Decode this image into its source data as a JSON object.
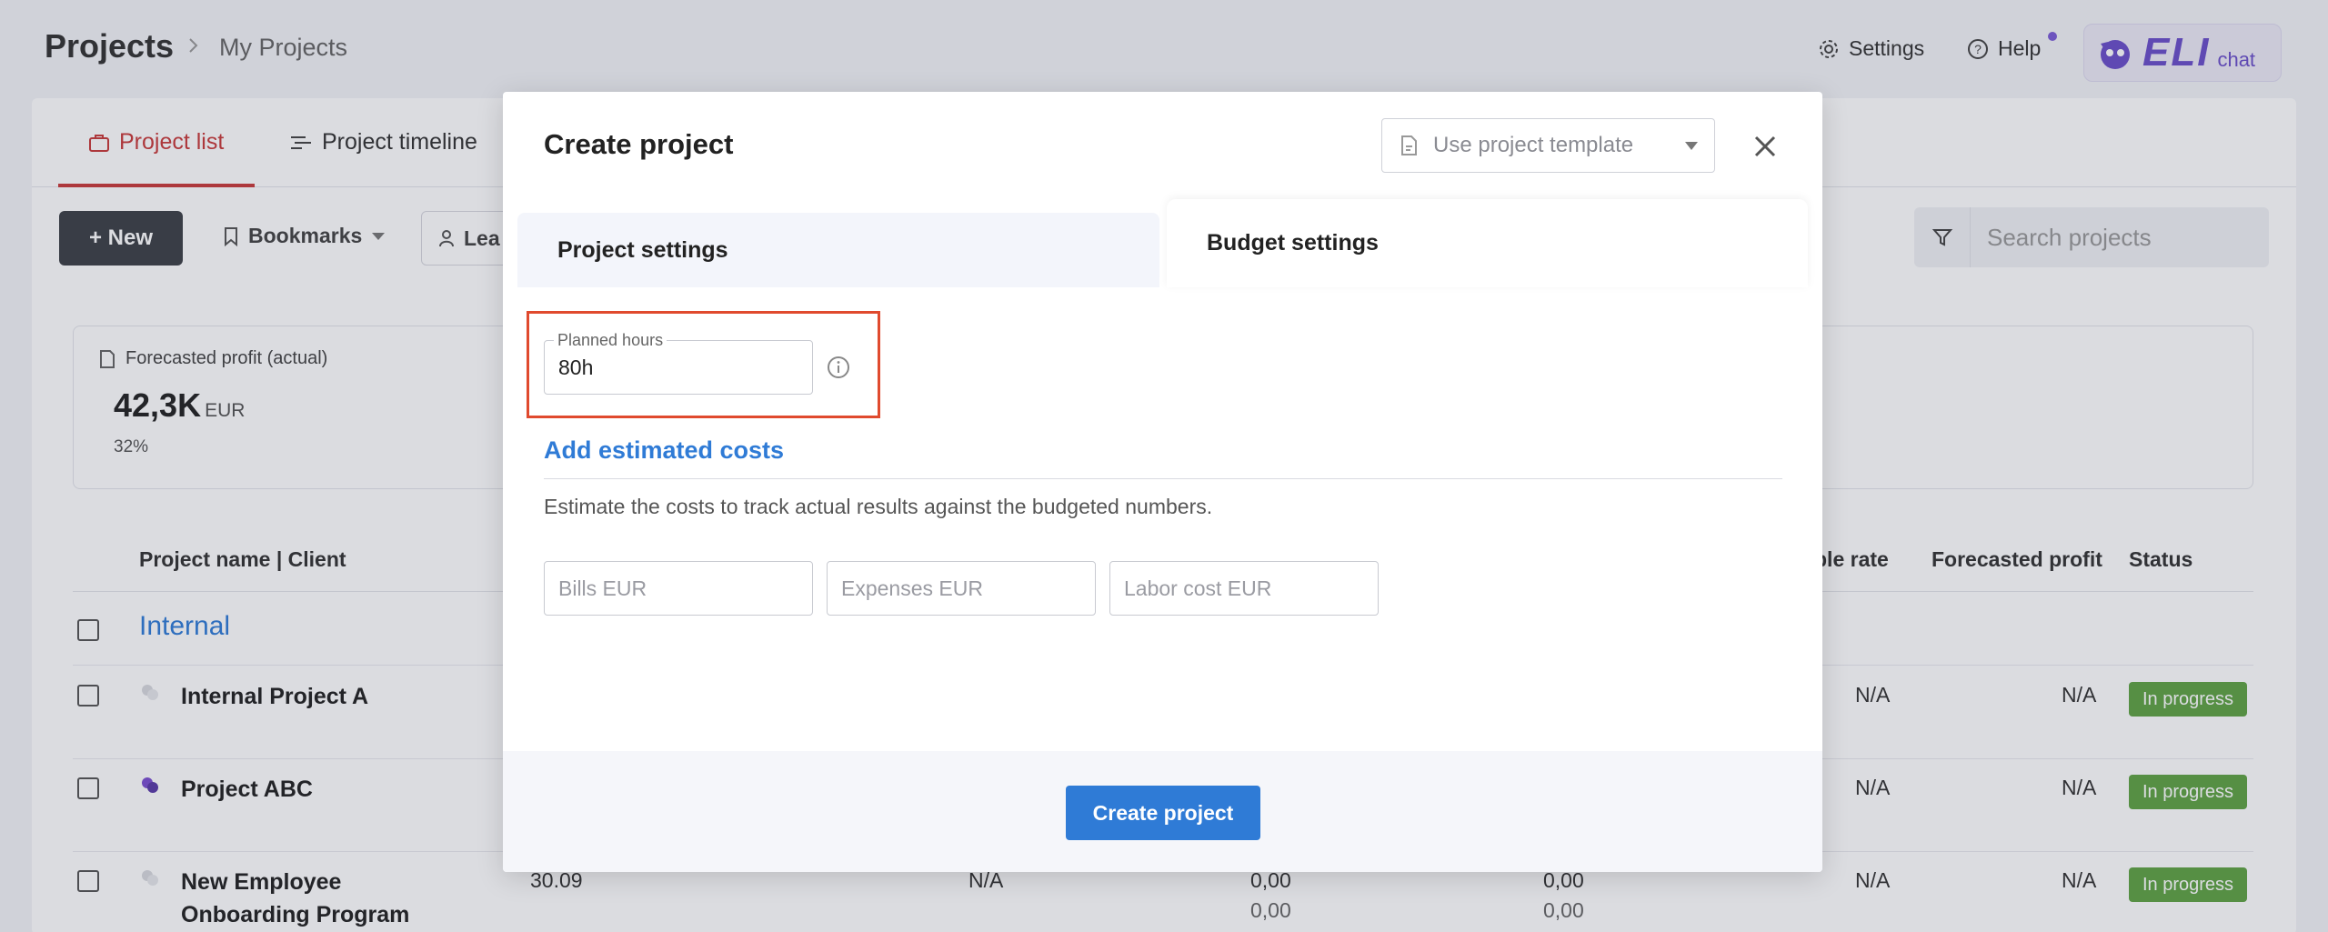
{
  "header": {
    "title": "Projects",
    "subtitle": "My Projects",
    "settings_label": "Settings",
    "help_label": "Help",
    "eli_word": "ELI",
    "eli_chat": "chat"
  },
  "tabs": [
    {
      "label": "Project list",
      "icon": "briefcase-icon",
      "active": true
    },
    {
      "label": "Project timeline",
      "icon": "timeline-icon",
      "active": false
    }
  ],
  "toolbar": {
    "new_label": "+ New",
    "bookmarks_label": "Bookmarks",
    "lead_label": "Lea",
    "search_placeholder": "Search projects"
  },
  "summary": {
    "label": "Forecasted profit (actual)",
    "value": "42,3K",
    "currency": "EUR",
    "percent": "32%"
  },
  "table": {
    "headers": {
      "name": "Project name | Client",
      "rate": "ble rate",
      "profit": "Forecasted profit",
      "status": "Status"
    },
    "group": "Internal",
    "rows": [
      {
        "name": "Internal Project A",
        "rate": "N/A",
        "profit": "N/A",
        "status": "In progress"
      },
      {
        "name": "Project ABC",
        "rate": "N/A",
        "profit": "N/A",
        "status": "In progress"
      },
      {
        "name_line1": "New Employee",
        "name_line2": "Onboarding Program",
        "date": "30.09",
        "col2": "N/A",
        "col3a": "0,00",
        "col3b": "0,00",
        "col4a": "0,00",
        "col4b": "0,00",
        "rate": "N/A",
        "profit": "N/A",
        "status": "In progress"
      }
    ]
  },
  "modal": {
    "title": "Create project",
    "template_placeholder": "Use project template",
    "tab_project": "Project settings",
    "tab_budget": "Budget settings",
    "planned_hours_label": "Planned hours",
    "planned_hours_value": "80h",
    "add_costs_label": "Add estimated costs",
    "description": "Estimate the costs to track actual results against the budgeted numbers.",
    "bills_placeholder": "Bills EUR",
    "expenses_placeholder": "Expenses EUR",
    "labor_placeholder": "Labor cost EUR",
    "create_button": "Create project"
  },
  "colors": {
    "accent_red": "#c83a3a",
    "link_blue": "#2f7bd6",
    "status_green": "#5fa344",
    "highlight": "#e04a2e",
    "eli_purple": "#6a4fc9"
  }
}
